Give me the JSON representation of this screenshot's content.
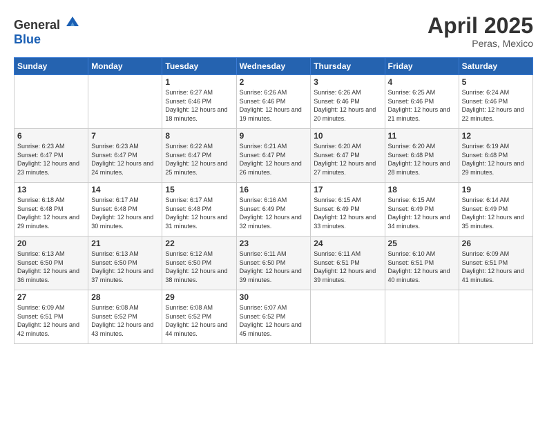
{
  "header": {
    "logo_general": "General",
    "logo_blue": "Blue",
    "month_title": "April 2025",
    "subtitle": "Peras, Mexico"
  },
  "days_of_week": [
    "Sunday",
    "Monday",
    "Tuesday",
    "Wednesday",
    "Thursday",
    "Friday",
    "Saturday"
  ],
  "weeks": [
    [
      {
        "day": "",
        "sunrise": "",
        "sunset": "",
        "daylight": ""
      },
      {
        "day": "",
        "sunrise": "",
        "sunset": "",
        "daylight": ""
      },
      {
        "day": "1",
        "sunrise": "Sunrise: 6:27 AM",
        "sunset": "Sunset: 6:46 PM",
        "daylight": "Daylight: 12 hours and 18 minutes."
      },
      {
        "day": "2",
        "sunrise": "Sunrise: 6:26 AM",
        "sunset": "Sunset: 6:46 PM",
        "daylight": "Daylight: 12 hours and 19 minutes."
      },
      {
        "day": "3",
        "sunrise": "Sunrise: 6:26 AM",
        "sunset": "Sunset: 6:46 PM",
        "daylight": "Daylight: 12 hours and 20 minutes."
      },
      {
        "day": "4",
        "sunrise": "Sunrise: 6:25 AM",
        "sunset": "Sunset: 6:46 PM",
        "daylight": "Daylight: 12 hours and 21 minutes."
      },
      {
        "day": "5",
        "sunrise": "Sunrise: 6:24 AM",
        "sunset": "Sunset: 6:46 PM",
        "daylight": "Daylight: 12 hours and 22 minutes."
      }
    ],
    [
      {
        "day": "6",
        "sunrise": "Sunrise: 6:23 AM",
        "sunset": "Sunset: 6:47 PM",
        "daylight": "Daylight: 12 hours and 23 minutes."
      },
      {
        "day": "7",
        "sunrise": "Sunrise: 6:23 AM",
        "sunset": "Sunset: 6:47 PM",
        "daylight": "Daylight: 12 hours and 24 minutes."
      },
      {
        "day": "8",
        "sunrise": "Sunrise: 6:22 AM",
        "sunset": "Sunset: 6:47 PM",
        "daylight": "Daylight: 12 hours and 25 minutes."
      },
      {
        "day": "9",
        "sunrise": "Sunrise: 6:21 AM",
        "sunset": "Sunset: 6:47 PM",
        "daylight": "Daylight: 12 hours and 26 minutes."
      },
      {
        "day": "10",
        "sunrise": "Sunrise: 6:20 AM",
        "sunset": "Sunset: 6:47 PM",
        "daylight": "Daylight: 12 hours and 27 minutes."
      },
      {
        "day": "11",
        "sunrise": "Sunrise: 6:20 AM",
        "sunset": "Sunset: 6:48 PM",
        "daylight": "Daylight: 12 hours and 28 minutes."
      },
      {
        "day": "12",
        "sunrise": "Sunrise: 6:19 AM",
        "sunset": "Sunset: 6:48 PM",
        "daylight": "Daylight: 12 hours and 29 minutes."
      }
    ],
    [
      {
        "day": "13",
        "sunrise": "Sunrise: 6:18 AM",
        "sunset": "Sunset: 6:48 PM",
        "daylight": "Daylight: 12 hours and 29 minutes."
      },
      {
        "day": "14",
        "sunrise": "Sunrise: 6:17 AM",
        "sunset": "Sunset: 6:48 PM",
        "daylight": "Daylight: 12 hours and 30 minutes."
      },
      {
        "day": "15",
        "sunrise": "Sunrise: 6:17 AM",
        "sunset": "Sunset: 6:48 PM",
        "daylight": "Daylight: 12 hours and 31 minutes."
      },
      {
        "day": "16",
        "sunrise": "Sunrise: 6:16 AM",
        "sunset": "Sunset: 6:49 PM",
        "daylight": "Daylight: 12 hours and 32 minutes."
      },
      {
        "day": "17",
        "sunrise": "Sunrise: 6:15 AM",
        "sunset": "Sunset: 6:49 PM",
        "daylight": "Daylight: 12 hours and 33 minutes."
      },
      {
        "day": "18",
        "sunrise": "Sunrise: 6:15 AM",
        "sunset": "Sunset: 6:49 PM",
        "daylight": "Daylight: 12 hours and 34 minutes."
      },
      {
        "day": "19",
        "sunrise": "Sunrise: 6:14 AM",
        "sunset": "Sunset: 6:49 PM",
        "daylight": "Daylight: 12 hours and 35 minutes."
      }
    ],
    [
      {
        "day": "20",
        "sunrise": "Sunrise: 6:13 AM",
        "sunset": "Sunset: 6:50 PM",
        "daylight": "Daylight: 12 hours and 36 minutes."
      },
      {
        "day": "21",
        "sunrise": "Sunrise: 6:13 AM",
        "sunset": "Sunset: 6:50 PM",
        "daylight": "Daylight: 12 hours and 37 minutes."
      },
      {
        "day": "22",
        "sunrise": "Sunrise: 6:12 AM",
        "sunset": "Sunset: 6:50 PM",
        "daylight": "Daylight: 12 hours and 38 minutes."
      },
      {
        "day": "23",
        "sunrise": "Sunrise: 6:11 AM",
        "sunset": "Sunset: 6:50 PM",
        "daylight": "Daylight: 12 hours and 39 minutes."
      },
      {
        "day": "24",
        "sunrise": "Sunrise: 6:11 AM",
        "sunset": "Sunset: 6:51 PM",
        "daylight": "Daylight: 12 hours and 39 minutes."
      },
      {
        "day": "25",
        "sunrise": "Sunrise: 6:10 AM",
        "sunset": "Sunset: 6:51 PM",
        "daylight": "Daylight: 12 hours and 40 minutes."
      },
      {
        "day": "26",
        "sunrise": "Sunrise: 6:09 AM",
        "sunset": "Sunset: 6:51 PM",
        "daylight": "Daylight: 12 hours and 41 minutes."
      }
    ],
    [
      {
        "day": "27",
        "sunrise": "Sunrise: 6:09 AM",
        "sunset": "Sunset: 6:51 PM",
        "daylight": "Daylight: 12 hours and 42 minutes."
      },
      {
        "day": "28",
        "sunrise": "Sunrise: 6:08 AM",
        "sunset": "Sunset: 6:52 PM",
        "daylight": "Daylight: 12 hours and 43 minutes."
      },
      {
        "day": "29",
        "sunrise": "Sunrise: 6:08 AM",
        "sunset": "Sunset: 6:52 PM",
        "daylight": "Daylight: 12 hours and 44 minutes."
      },
      {
        "day": "30",
        "sunrise": "Sunrise: 6:07 AM",
        "sunset": "Sunset: 6:52 PM",
        "daylight": "Daylight: 12 hours and 45 minutes."
      },
      {
        "day": "",
        "sunrise": "",
        "sunset": "",
        "daylight": ""
      },
      {
        "day": "",
        "sunrise": "",
        "sunset": "",
        "daylight": ""
      },
      {
        "day": "",
        "sunrise": "",
        "sunset": "",
        "daylight": ""
      }
    ]
  ]
}
